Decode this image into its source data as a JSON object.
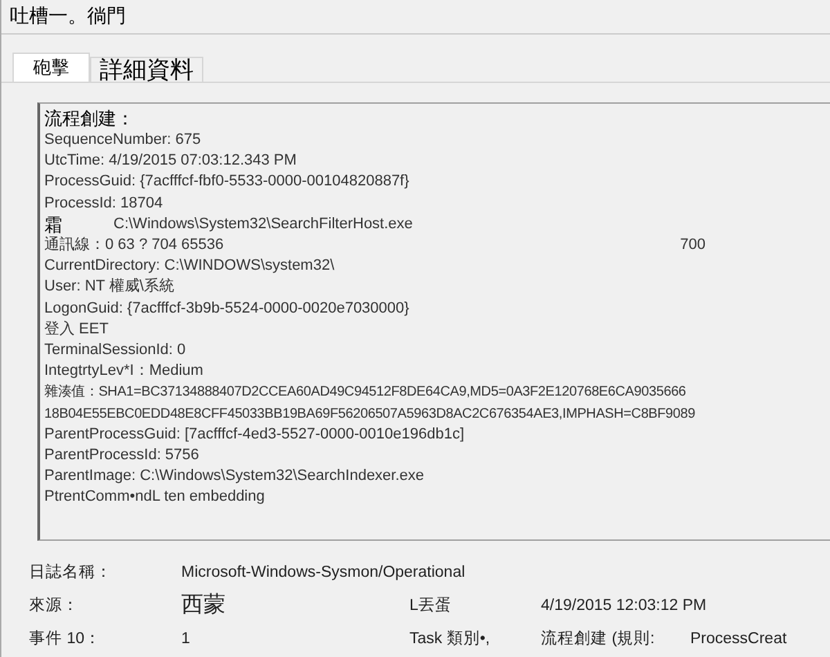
{
  "window": {
    "title": "吐槽一。徜門"
  },
  "tabs": [
    {
      "label": "砲擊",
      "selected": true
    },
    {
      "label": "詳細資料",
      "selected": false
    }
  ],
  "event_text": {
    "heading": "流程創建：",
    "lines": [
      {
        "text": "SequenceNumber: 675"
      },
      {
        "text": "UtcTime: 4/19/2015 07:03:12.343 PM"
      },
      {
        "text": "ProcessGuid: {7acfffcf-fbf0-5533-0000-00104820887f}"
      },
      {
        "text": "ProcessId: 18704"
      },
      {
        "label": "霜",
        "text": "C:\\Windows\\System32\\SearchFilterHost.exe"
      },
      {
        "text": "通訊線：0 63 ? 704 65536",
        "aside": "700"
      },
      {
        "text": "CurrentDirectory: C:\\WINDOWS\\system32\\"
      },
      {
        "text": "User: NT 權威\\系統"
      },
      {
        "text": "LogonGuid: {7acfffcf-3b9b-5524-0000-0020e7030000}"
      },
      {
        "text": "登入 EET"
      },
      {
        "text": "TerminalSessionId: 0"
      },
      {
        "text": "IntegtrtyLev*I：Medium"
      },
      {
        "text": "雜湊值：SHA1=BC37134888407D2CCEA60AD49C94512F8DE64CA9,MD5=0A3F2E120768E6CA9035666"
      },
      {
        "text": "18B04E55EBC0EDD48E8CFF45033BB19BA69F56206507A5963D8AC2C676354AE3,IMPHASH=C8BF9089"
      },
      {
        "text": "ParentProcessGuid: [7acfffcf-4ed3-5527-0000-0010e196db1c]"
      },
      {
        "text": "ParentProcessId: 5756"
      },
      {
        "text": "ParentImage: C:\\Windows\\System32\\SearchIndexer.exe"
      },
      {
        "text": "PtrentComm•ndL ten embedding"
      }
    ]
  },
  "details": [
    [
      "日誌名稱：",
      "Microsoft-Windows-Sysmon/Operational"
    ],
    [
      "來源：",
      "西蒙",
      "L丟蛋",
      "4/19/2015 12:03:12 PM"
    ],
    [
      "事件 10：",
      "1",
      "Task 類別•,",
      "流程創建 (規則:",
      "ProcessCreat"
    ]
  ]
}
